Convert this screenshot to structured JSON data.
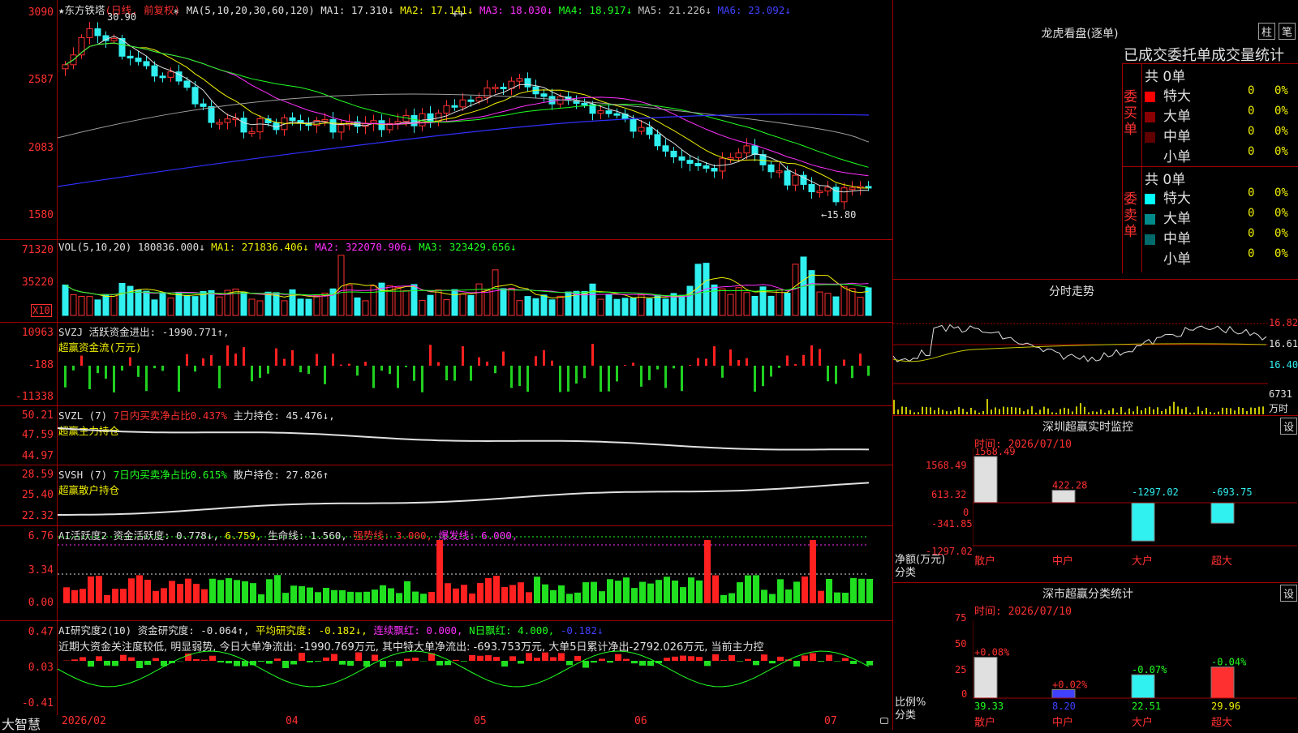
{
  "main": {
    "star": "★",
    "stock_name": "东方铁塔",
    "period": "(日线, 前复权)",
    "ma_params": "MA(5,10,20,30,60,120)",
    "ma": [
      {
        "label": "MA1: 17.310↓",
        "color": "#e0e0e0"
      },
      {
        "label": "MA2: 17.141↓",
        "color": "#f0f000"
      },
      {
        "label": "MA3: 18.030↓",
        "color": "#ff30ff"
      },
      {
        "label": "MA4: 18.917↓",
        "color": "#20ff20"
      },
      {
        "label": "MA5: 21.226↓",
        "color": "#c0c0c0"
      },
      {
        "label": "MA6: 23.092↓",
        "color": "#4040ff"
      }
    ],
    "y_labels": [
      "3090",
      "2587",
      "2083",
      "1580"
    ],
    "high_label": "30.90",
    "low_label": "←15.80",
    "star_marks": "*",
    "plus_marks": "++"
  },
  "vol": {
    "title": "VOL(5,10,20)",
    "value": "180836.000↓",
    "ma1": "MA1: 271836.406↓",
    "ma2": "MA2: 322070.906↓",
    "ma3": "MA3: 323429.656↓",
    "y_labels": [
      "71320",
      "35220"
    ],
    "unit": "X10"
  },
  "svzj": {
    "title": "SVZJ",
    "desc": "活跃资金进出: -1990.771↑,",
    "sub": "超赢资金流(万元)",
    "y_labels": [
      "10963",
      "-188",
      "-11338"
    ]
  },
  "svzl": {
    "title": "SVZL (7)",
    "desc": "7日内买卖净占比0.437%",
    "hold": "主力持仓: 45.476↓,",
    "sub": "超赢主力持仓",
    "y_labels": [
      "50.21",
      "47.59",
      "44.97"
    ]
  },
  "svsh": {
    "title": "SVSH (7)",
    "desc": "7日内买卖净占比0.615%",
    "hold": "散户持仓: 27.826↑",
    "sub": "超赢散户持仓",
    "y_labels": [
      "28.59",
      "25.40",
      "22.32"
    ]
  },
  "ai1": {
    "title": "AI活跃度2",
    "a": "资金活跃度: 0.778↓,",
    "b": "6.759,",
    "c": "生命线: 1.560,",
    "d": "强势线: 3.000,",
    "e": "爆发线: 6.000,",
    "y_labels": [
      "6.76",
      "3.34",
      "0.00"
    ]
  },
  "ai2": {
    "title": "AI研究度2(10)",
    "a": "资金研究度: -0.064↑,",
    "b": "平均研究度: -0.182↓,",
    "c": "连续飘红: 0.000,",
    "d": "N日飘红: 4.000,",
    "e": "-0.182↓",
    "note": "近期大资金关注度较低, 明显弱势, 今日大单净流出: -1990.769万元, 其中特大单净流出: -693.753万元, 大单5日累计净出-2792.026万元, 当前主力控",
    "y_labels": [
      "0.47",
      "0.03",
      "-0.41"
    ]
  },
  "footer": {
    "brand": "大智慧",
    "dates": [
      "2026/02",
      "04",
      "05",
      "06",
      "07"
    ]
  },
  "right": {
    "lhb_title": "龙虎看盘(逐单)",
    "btn_column": "柱",
    "btn_stroke": "笔",
    "stats_header": "已成交委托单成交量统计",
    "buy_label": "委买单",
    "sell_label": "委卖单",
    "buy_total": "共 0单",
    "sell_total": "共 0单",
    "buy_rows": [
      {
        "label": "特大",
        "v": "0",
        "p": "0%",
        "color": "#ff0000"
      },
      {
        "label": "大单",
        "v": "0",
        "p": "0%",
        "color": "#8a0000"
      },
      {
        "label": "中单",
        "v": "0",
        "p": "0%",
        "color": "#600000"
      },
      {
        "label": "小单",
        "v": "0",
        "p": "0%",
        "color": "#000000"
      }
    ],
    "sell_rows": [
      {
        "label": "特大",
        "v": "0",
        "p": "0%",
        "color": "#00ffff"
      },
      {
        "label": "大单",
        "v": "0",
        "p": "0%",
        "color": "#008a8a"
      },
      {
        "label": "中单",
        "v": "0",
        "p": "0%",
        "color": "#006a6a"
      },
      {
        "label": "小单",
        "v": "0",
        "p": "0%",
        "color": "#000000"
      }
    ],
    "intraday_title": "分时走势",
    "intraday_prices": [
      "16.82",
      "16.61",
      "16.40"
    ],
    "intraday_vol": "6731",
    "intraday_unit": "万时",
    "sz_title": "深圳超赢实时监控",
    "sz_setting": "设",
    "sz_time": "时间: 2026/07/10",
    "sz_y_labels": [
      "1568.49",
      "613.32",
      "0",
      "-341.85",
      "-1297.02"
    ],
    "sz_values": [
      "1568.49",
      "422.28",
      "-1297.02",
      "-693.75"
    ],
    "sz_axis_label": "净额(万元)",
    "sz_cat_label": "分类",
    "categories": [
      "散户",
      "中户",
      "大户",
      "超大"
    ],
    "sc_title": "深市超赢分类统计",
    "sc_setting": "设",
    "sc_time": "时间: 2026/07/10",
    "sc_y_labels": [
      "75",
      "50",
      "25",
      "0"
    ],
    "sc_changes": [
      "+0.08%",
      "+0.02%",
      "-0.07%",
      "-0.04%"
    ],
    "sc_values": [
      "39.33",
      "8.20",
      "22.51",
      "29.96"
    ],
    "sc_axis_label": "比例%",
    "sc_cat_label": "分类"
  }
}
